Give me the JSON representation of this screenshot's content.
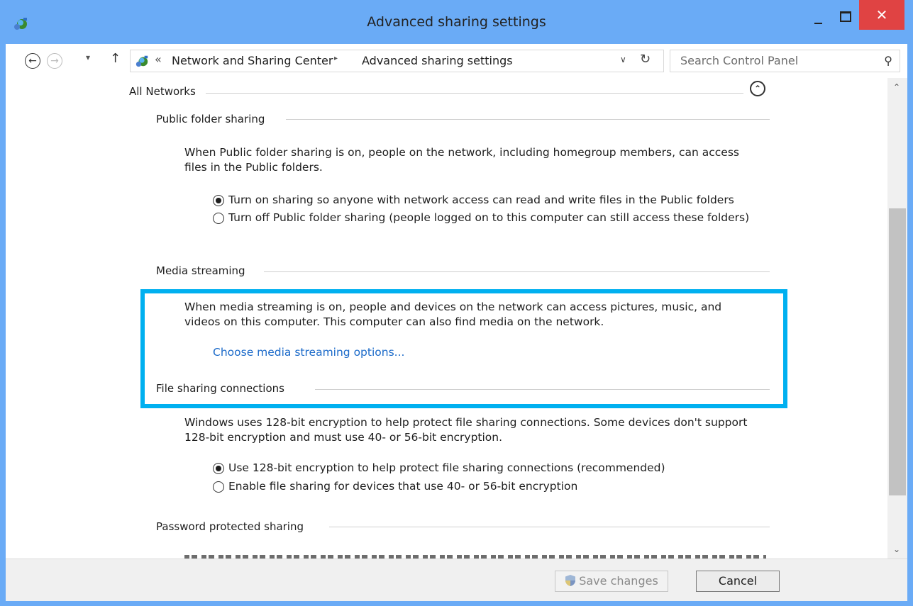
{
  "window": {
    "title": "Advanced sharing settings",
    "close_glyph": "✕"
  },
  "nav": {
    "back_glyph": "←",
    "forward_glyph": "→",
    "recent_glyph": "▾",
    "up_glyph": "↑",
    "address": {
      "overflow": "«",
      "segments": [
        "Network and Sharing Center",
        "Advanced sharing settings"
      ],
      "separator": "▸",
      "dropdown_glyph": "∨",
      "refresh_glyph": "↻"
    },
    "search": {
      "placeholder": "Search Control Panel",
      "icon": "⚲"
    }
  },
  "content": {
    "all_networks": {
      "label": "All Networks",
      "collapse_glyph": "⌃"
    },
    "public_folder": {
      "heading": "Public folder sharing",
      "description": "When Public folder sharing is on, people on the network, including homegroup members, can access files in the Public folders.",
      "options": [
        {
          "label": "Turn on sharing so anyone with network access can read and write files in the Public folders",
          "selected": true
        },
        {
          "label": "Turn off Public folder sharing (people logged on to this computer can still access these folders)",
          "selected": false
        }
      ]
    },
    "media_streaming": {
      "heading": "Media streaming",
      "description": "When media streaming is on, people and devices on the network can access pictures, music, and videos on this computer. This computer can also find media on the network.",
      "link": "Choose media streaming options..."
    },
    "file_sharing": {
      "heading": "File sharing connections",
      "description": "Windows uses 128-bit encryption to help protect file sharing connections. Some devices don't support 128-bit encryption and must use 40- or 56-bit encryption.",
      "options": [
        {
          "label": "Use 128-bit encryption to help protect file sharing connections (recommended)",
          "selected": true
        },
        {
          "label": "Enable file sharing for devices that use 40- or 56-bit encryption",
          "selected": false
        }
      ]
    },
    "password_sharing": {
      "heading": "Password protected sharing"
    }
  },
  "scrollbar": {
    "up_glyph": "⌃",
    "down_glyph": "⌄"
  },
  "footer": {
    "save_label": "Save changes",
    "cancel_label": "Cancel"
  },
  "colors": {
    "titlebar": "#6aabf6",
    "close": "#e04343",
    "highlight": "#00b0f0",
    "link": "#1b6ac9"
  }
}
